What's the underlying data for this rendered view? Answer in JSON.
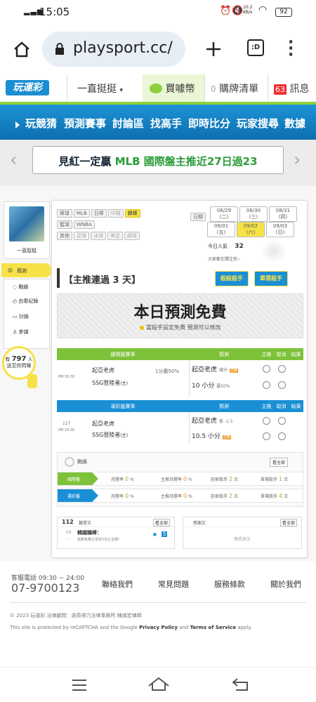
{
  "status": {
    "time": "15:05",
    "speed": "10.2 KB/s",
    "battery": "92"
  },
  "browser": {
    "url": "playsport.cc/",
    "tab_count_label": ":D"
  },
  "topbar": {
    "logo": "玩運彩",
    "dropdown": "一直挺挺",
    "buy_coin": "買噱幣",
    "cart_count": "0",
    "cart": "購牌清單",
    "msg_count": "63",
    "msg": "訊息"
  },
  "nav": [
    "玩競猜",
    "預測賽事",
    "討論區",
    "找高手",
    "即時比分",
    "玩家搜尋",
    "數據"
  ],
  "banner": {
    "text_prefix": "見紅一定贏",
    "text_green": "MLB 國際盤主推近27日過23"
  },
  "sidebar": {
    "username": "一直挺挺",
    "items": [
      "預測",
      "戰績",
      "由看紀錄",
      "討論",
      "參謀"
    ],
    "count_prefix": "有",
    "count": "797",
    "count_suffix": "人",
    "count_line2": "送至你閃噱"
  },
  "filters": {
    "row1_label": "棒球",
    "row1": [
      "MLB",
      "日棒",
      "中職",
      "韓棒"
    ],
    "row2_label": "籃球",
    "row2": [
      "WNBA"
    ],
    "row3_label": "其他",
    "row3": [
      "足球",
      "冰球",
      "美足",
      "網球"
    ]
  },
  "dates": {
    "label": "日期",
    "row1": [
      "08/29 (二)",
      "08/30 (三)",
      "08/31 (四)"
    ],
    "row2": [
      "09/01 (五)",
      "09/02 (六)",
      "09/03 (日)"
    ]
  },
  "today": {
    "label": "今日人氣",
    "value": "32",
    "note": "大家都在關注你~"
  },
  "title": "【主推連過 3 天】",
  "badges": {
    "b1": "殺殺殺手",
    "b2": "單猜殺手"
  },
  "free": {
    "title": "本日預測免費",
    "sub": "當殺手設定免費  預測可以修改"
  },
  "intl": {
    "header": [
      "國際盤賽事",
      "預測",
      "主推",
      "取消",
      "結果"
    ],
    "time": "PM 16:30",
    "team1": "起亞老虎",
    "team2": "SSG登陸者",
    "handicap": "1分贏50%",
    "team2_mark": "(主)",
    "pick1": "起亞老虎",
    "pick1_note": "讓分",
    "pick2": "10 小分",
    "pick2_note": "贏50%"
  },
  "local": {
    "header": [
      "運彩盤賽事",
      "預測",
      "主推",
      "取消",
      "結果"
    ],
    "num": "127",
    "time": "PM 16:30",
    "team1": "起亞老虎",
    "team2": "SSG登陸者",
    "team2_mark": "(主)",
    "pick1": "起亞老虎",
    "pick1_note": "客 -1.5",
    "pick2": "10.5 小分"
  },
  "record": {
    "title": "戰績",
    "view_all": "看全部",
    "rows": [
      {
        "label": "國際盤",
        "cells": [
          "月勝率",
          "0",
          "%",
          "主推月勝率",
          "0",
          "%",
          "莊家殺手",
          "2",
          "次",
          "單場殺手",
          "1",
          "次"
        ]
      },
      {
        "label": "運彩盤",
        "cells": [
          "月勝率",
          "0",
          "%",
          "主推月勝率",
          "0",
          "%",
          "莊家殺手",
          "2",
          "次",
          "單場殺手",
          "4",
          "次"
        ]
      }
    ]
  },
  "posts": {
    "count": "112",
    "label": "篇發文",
    "view_all": "看全部",
    "date": "09",
    "time": "--:--",
    "title": "韓國職棒：",
    "desc": "我數免費分享有5日止全勝！",
    "reply": "5"
  },
  "replies": {
    "title": "感謝文",
    "view_all": "看全部",
    "empty": "無感謝文"
  },
  "footer": {
    "phone_label": "客服電話 09:30 ~ 24:00",
    "phone": "07-9700123",
    "links": [
      "聯絡我們",
      "常見問題",
      "服務條款",
      "關於我們"
    ],
    "copyright": "© 2023 玩運彩 法律顧問：遠英得力法律事務所 陳威宏律師",
    "recaptcha_pre": "This site is protected by reCAPTCHA and the Google",
    "privacy": "Privacy Policy",
    "and": "and",
    "terms": "Terms of Service",
    "apply": "apply."
  },
  "colors": {
    "green": "#8ccf3c",
    "blue": "#1a8fd5",
    "nav": "#0c6fb0",
    "yellow": "#f6e247"
  }
}
